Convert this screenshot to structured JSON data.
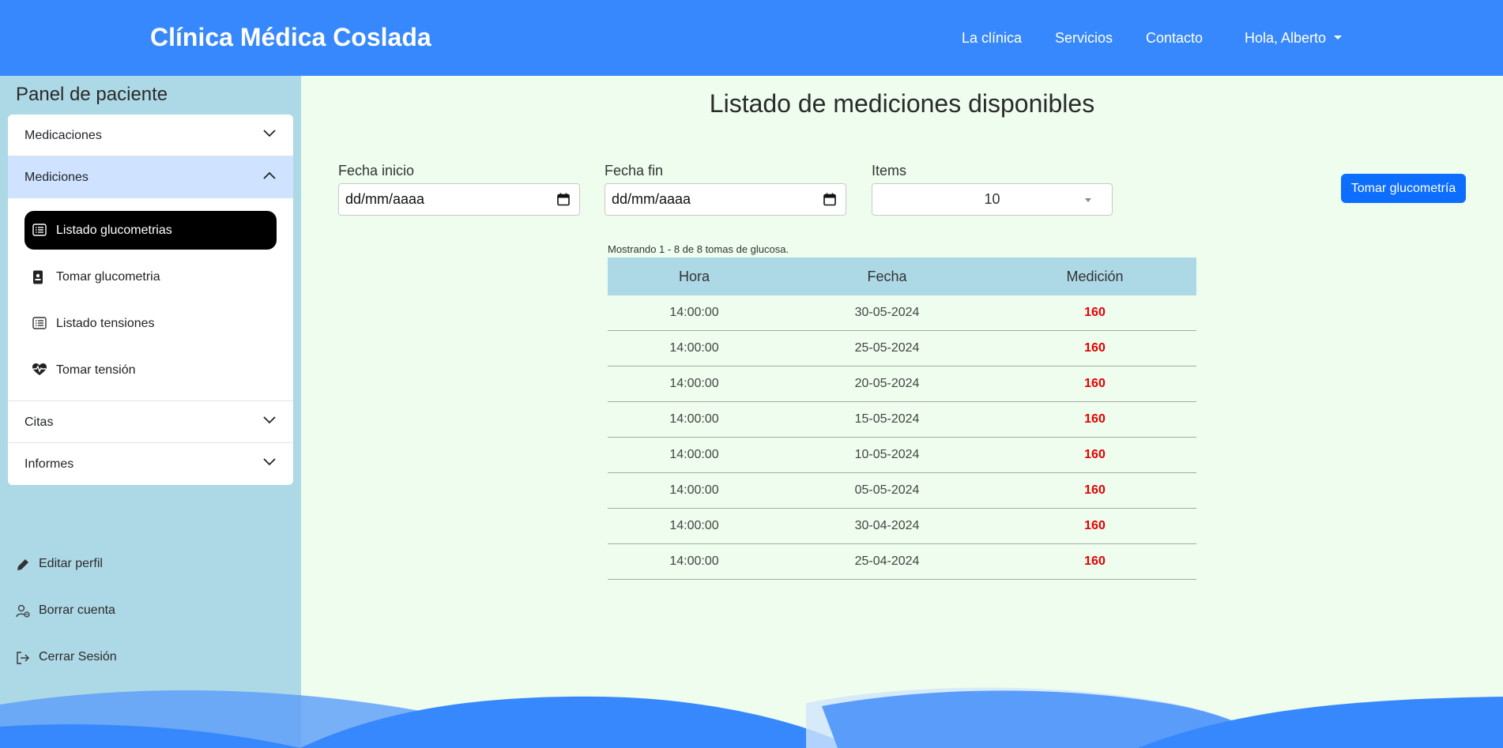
{
  "navbar": {
    "brand": "Clínica Médica Coslada",
    "links": [
      "La clínica",
      "Servicios",
      "Contacto"
    ],
    "user_menu": "Hola, Alberto"
  },
  "sidebar": {
    "title": "Panel de paciente",
    "sections": [
      "Medicaciones",
      "Mediciones",
      "Citas",
      "Informes"
    ],
    "mediciones_items": [
      {
        "label": "Listado glucometrias",
        "icon": "list-icon"
      },
      {
        "label": "Tomar glucometria",
        "icon": "badge-icon"
      },
      {
        "label": "Listado tensiones",
        "icon": "list-icon"
      },
      {
        "label": "Tomar tensión",
        "icon": "heart-pulse-icon"
      }
    ],
    "bottom_links": [
      {
        "label": "Editar perfil",
        "icon": "pencil-icon"
      },
      {
        "label": "Borrar cuenta",
        "icon": "person-remove-icon"
      },
      {
        "label": "Cerrar Sesión",
        "icon": "logout-icon"
      }
    ]
  },
  "main": {
    "title": "Listado de mediciones disponibles",
    "filters": {
      "start_label": "Fecha inicio",
      "start_value": "dd/mm/aaaa",
      "end_label": "Fecha fin",
      "end_value": "dd/mm/aaaa",
      "items_label": "Items",
      "items_value": "10"
    },
    "action_button": "Tomar glucometría",
    "showing_text": "Mostrando 1 - 8 de 8 tomas de glucosa.",
    "table": {
      "headers": [
        "Hora",
        "Fecha",
        "Medición"
      ],
      "rows": [
        [
          "14:00:00",
          "30-05-2024",
          "160"
        ],
        [
          "14:00:00",
          "25-05-2024",
          "160"
        ],
        [
          "14:00:00",
          "20-05-2024",
          "160"
        ],
        [
          "14:00:00",
          "15-05-2024",
          "160"
        ],
        [
          "14:00:00",
          "10-05-2024",
          "160"
        ],
        [
          "14:00:00",
          "05-05-2024",
          "160"
        ],
        [
          "14:00:00",
          "30-04-2024",
          "160"
        ],
        [
          "14:00:00",
          "25-04-2024",
          "160"
        ]
      ]
    }
  },
  "colors": {
    "navbar": "#3788fc",
    "sidebar": "#add8e6",
    "content_bg": "#eefdee",
    "primary_button": "#0d6efd",
    "measurement_value": "#e60000"
  }
}
